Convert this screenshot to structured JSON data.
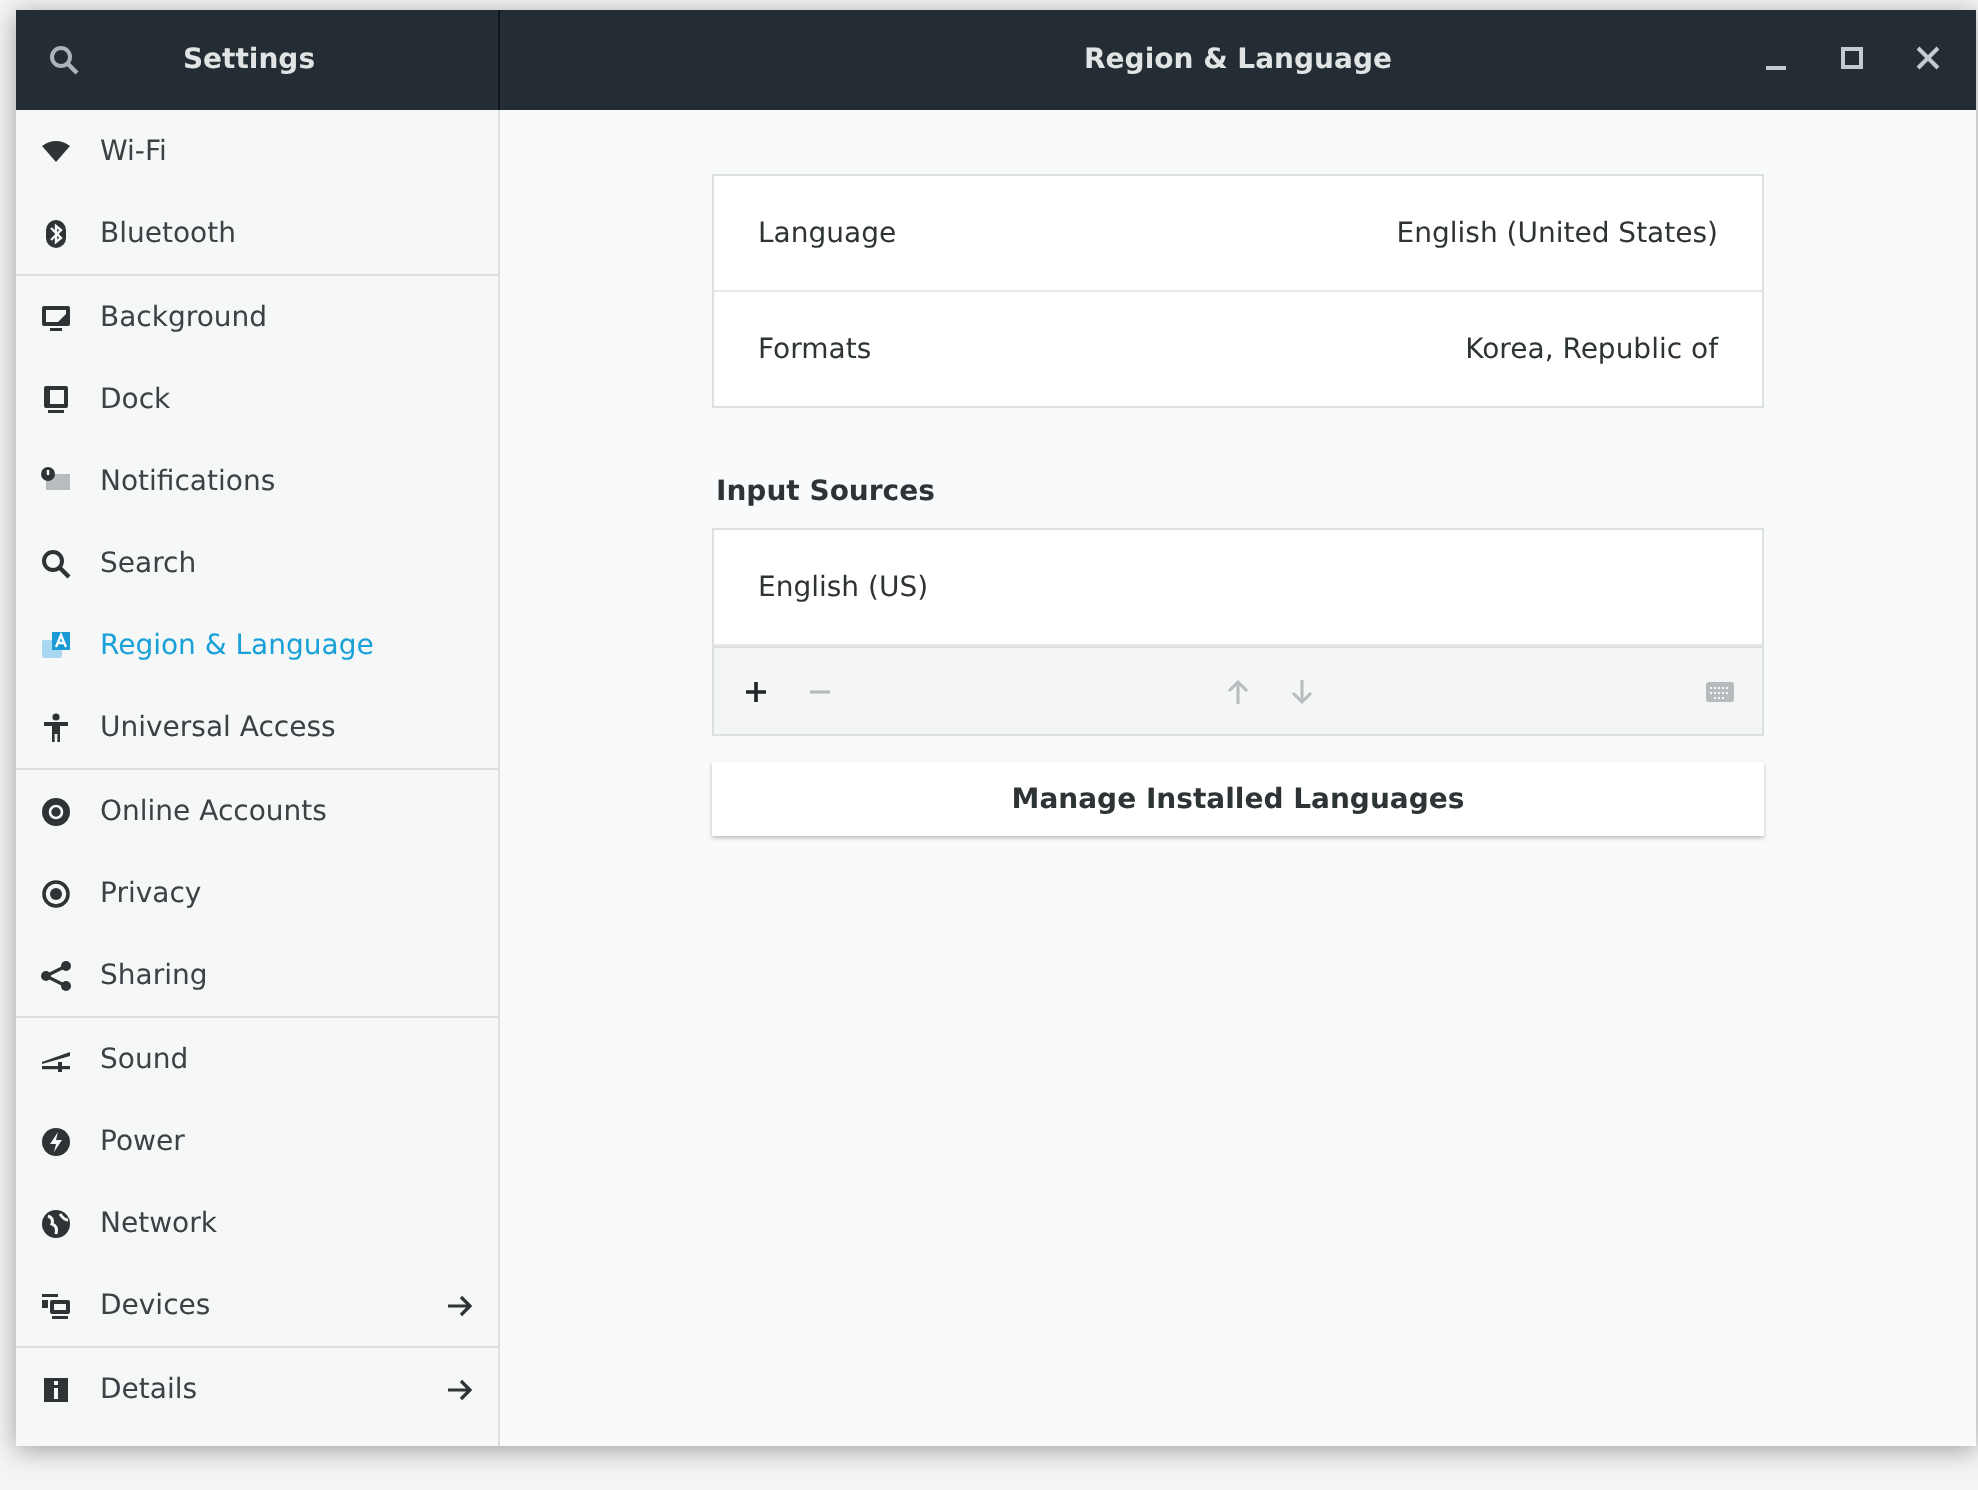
{
  "sidebar": {
    "title": "Settings",
    "groups": [
      {
        "items": [
          {
            "label": "Wi-Fi",
            "selected": false,
            "subpage": false
          },
          {
            "label": "Bluetooth",
            "selected": false,
            "subpage": false
          }
        ]
      },
      {
        "items": [
          {
            "label": "Background",
            "selected": false,
            "subpage": false
          },
          {
            "label": "Dock",
            "selected": false,
            "subpage": false
          },
          {
            "label": "Notifications",
            "selected": false,
            "subpage": false
          },
          {
            "label": "Search",
            "selected": false,
            "subpage": false
          },
          {
            "label": "Region & Language",
            "selected": true,
            "subpage": false
          },
          {
            "label": "Universal Access",
            "selected": false,
            "subpage": false
          }
        ]
      },
      {
        "items": [
          {
            "label": "Online Accounts",
            "selected": false,
            "subpage": false
          },
          {
            "label": "Privacy",
            "selected": false,
            "subpage": false
          },
          {
            "label": "Sharing",
            "selected": false,
            "subpage": false
          }
        ]
      },
      {
        "items": [
          {
            "label": "Sound",
            "selected": false,
            "subpage": false
          },
          {
            "label": "Power",
            "selected": false,
            "subpage": false
          },
          {
            "label": "Network",
            "selected": false,
            "subpage": false
          },
          {
            "label": "Devices",
            "selected": false,
            "subpage": true
          }
        ]
      },
      {
        "items": [
          {
            "label": "Details",
            "selected": false,
            "subpage": true
          }
        ]
      }
    ]
  },
  "window": {
    "title": "Region & Language"
  },
  "settings": [
    {
      "label": "Language",
      "value": "English (United States)"
    },
    {
      "label": "Formats",
      "value": "Korea, Republic of"
    }
  ],
  "input_sources": {
    "heading": "Input Sources",
    "items": [
      "English (US)"
    ],
    "toolbar": [
      {
        "kind": "add",
        "disabled": false
      },
      {
        "kind": "remove",
        "disabled": true
      },
      {
        "kind": "up",
        "disabled": true
      },
      {
        "kind": "down",
        "disabled": true
      },
      {
        "kind": "keyboard",
        "disabled": true
      }
    ]
  },
  "button": "Manage Installed Languages"
}
